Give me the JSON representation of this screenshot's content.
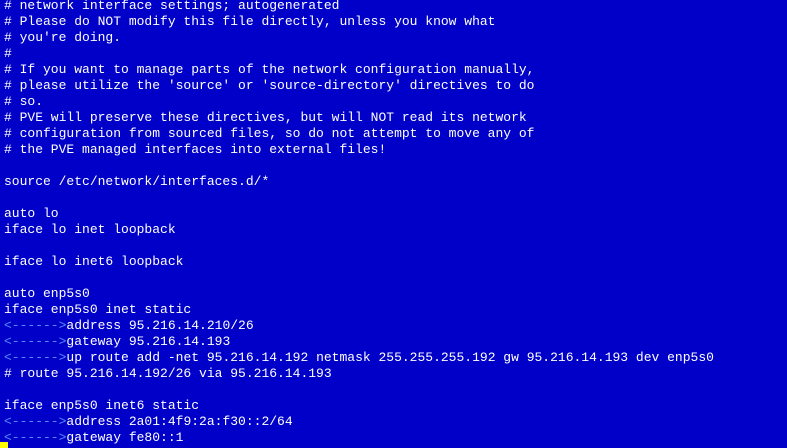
{
  "editor": {
    "tab_marker": "<------>",
    "lines": [
      {
        "kind": "text",
        "text": "# network interface settings; autogenerated"
      },
      {
        "kind": "text",
        "text": "# Please do NOT modify this file directly, unless you know what"
      },
      {
        "kind": "text",
        "text": "# you're doing."
      },
      {
        "kind": "text",
        "text": "#"
      },
      {
        "kind": "text",
        "text": "# If you want to manage parts of the network configuration manually,"
      },
      {
        "kind": "text",
        "text": "# please utilize the 'source' or 'source-directory' directives to do"
      },
      {
        "kind": "text",
        "text": "# so."
      },
      {
        "kind": "text",
        "text": "# PVE will preserve these directives, but will NOT read its network"
      },
      {
        "kind": "text",
        "text": "# configuration from sourced files, so do not attempt to move any of"
      },
      {
        "kind": "text",
        "text": "# the PVE managed interfaces into external files!"
      },
      {
        "kind": "text",
        "text": ""
      },
      {
        "kind": "text",
        "text": "source /etc/network/interfaces.d/*"
      },
      {
        "kind": "text",
        "text": ""
      },
      {
        "kind": "text",
        "text": "auto lo"
      },
      {
        "kind": "text",
        "text": "iface lo inet loopback"
      },
      {
        "kind": "text",
        "text": ""
      },
      {
        "kind": "text",
        "text": "iface lo inet6 loopback"
      },
      {
        "kind": "text",
        "text": ""
      },
      {
        "kind": "text",
        "text": "auto enp5s0"
      },
      {
        "kind": "text",
        "text": "iface enp5s0 inet static"
      },
      {
        "kind": "tab",
        "text": "address 95.216.14.210/26"
      },
      {
        "kind": "tab",
        "text": "gateway 95.216.14.193"
      },
      {
        "kind": "tab",
        "text": "up route add -net 95.216.14.192 netmask 255.255.255.192 gw 95.216.14.193 dev enp5s0"
      },
      {
        "kind": "text",
        "text": "# route 95.216.14.192/26 via 95.216.14.193"
      },
      {
        "kind": "text",
        "text": ""
      },
      {
        "kind": "text",
        "text": "iface enp5s0 inet6 static"
      },
      {
        "kind": "tab",
        "text": "address 2a01:4f9:2a:f30::2/64"
      },
      {
        "kind": "tab",
        "text": "gateway fe80::1"
      }
    ]
  },
  "colors": {
    "background": "#0000c8",
    "text": "#ffffff",
    "tab_marker": "#5a8cff",
    "cursor": "#ffff00"
  }
}
